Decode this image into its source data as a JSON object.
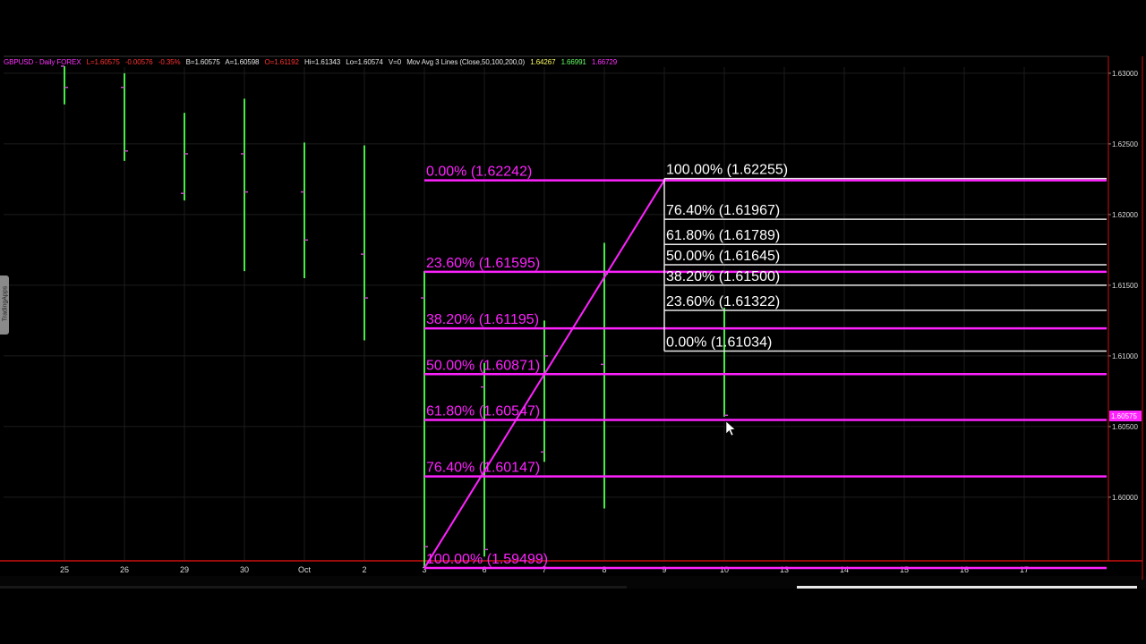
{
  "info": {
    "symbol": "GBPUSD - Daily FOREX",
    "last": "L=1.60575",
    "change": "-0.00576",
    "change_pct": "-0.35%",
    "bid": "B=1.60575",
    "ask": "A=1.60598",
    "open": "O=1.61192",
    "hi": "Hi=1.61343",
    "lo": "Lo=1.60574",
    "volume": "V=0",
    "ma_label": "Mov Avg 3 Lines (Close,50,100,200,0)",
    "ma1": "1.64267",
    "ma2": "1.66991",
    "ma3": "1.66729"
  },
  "side_tab": {
    "label": "TradingApps"
  },
  "colors": {
    "bar": "#44ee44",
    "fib_retrace": "#ff22ff",
    "fib_ext": "#e8e8e8",
    "axis": "#cc1111",
    "grid": "#1c1c1c",
    "price_tag": "#ff22ff"
  },
  "chart_data": {
    "type": "bar",
    "title": "",
    "xlabel": "",
    "ylabel": "",
    "ylim": [
      1.5955,
      1.6307
    ],
    "grid": true,
    "x_tick_labels": [
      "25",
      "26",
      "29",
      "30",
      "Oct",
      "2",
      "3",
      "6",
      "7",
      "8",
      "9",
      "10",
      "13",
      "14",
      "15",
      "16",
      "17"
    ],
    "y_tick_labels": [
      "1.63000",
      "1.62500",
      "1.62000",
      "1.61500",
      "1.61000",
      "1.60500",
      "1.60000"
    ],
    "y_tick_values": [
      1.63,
      1.625,
      1.62,
      1.615,
      1.61,
      1.605,
      1.6
    ],
    "current_price": "1.60575",
    "bars": [
      {
        "date": "25",
        "high": 1.6305,
        "low": 1.6278,
        "open": 1.6305,
        "close": 1.629
      },
      {
        "date": "26",
        "high": 1.63,
        "low": 1.6238,
        "open": 1.629,
        "close": 1.6245
      },
      {
        "date": "29",
        "high": 1.6272,
        "low": 1.621,
        "open": 1.6215,
        "close": 1.6243
      },
      {
        "date": "30",
        "high": 1.6282,
        "low": 1.616,
        "open": 1.6243,
        "close": 1.6216
      },
      {
        "date": "Oct",
        "high": 1.6251,
        "low": 1.6155,
        "open": 1.6216,
        "close": 1.6182
      },
      {
        "date": "2",
        "high": 1.6249,
        "low": 1.6111,
        "open": 1.6172,
        "close": 1.6141
      },
      {
        "date": "3",
        "high": 1.616,
        "low": 1.595,
        "open": 1.6141,
        "close": 1.5965
      },
      {
        "date": "6",
        "high": 1.6095,
        "low": 1.5958,
        "open": 1.6078,
        "close": 1.5963
      },
      {
        "date": "7",
        "high": 1.6125,
        "low": 1.6025,
        "open": 1.6032,
        "close": 1.61
      },
      {
        "date": "8",
        "high": 1.618,
        "low": 1.5992,
        "open": 1.6094,
        "close": 1.6158
      },
      {
        "date": "10",
        "high": 1.6134,
        "low": 1.6057,
        "open": 1.6119,
        "close": 1.6058
      }
    ],
    "fib_retracement": {
      "swing": {
        "from_date": "3",
        "from_price": 1.59499,
        "to_date": "9",
        "to_price": 1.62242
      },
      "levels": [
        {
          "label": "0.00% (1.62242)",
          "price": 1.62242
        },
        {
          "label": "23.60% (1.61595)",
          "price": 1.61595
        },
        {
          "label": "38.20% (1.61195)",
          "price": 1.61195
        },
        {
          "label": "50.00% (1.60871)",
          "price": 1.60871
        },
        {
          "label": "61.80% (1.60547)",
          "price": 1.60547
        },
        {
          "label": "76.40% (1.60147)",
          "price": 1.60147
        },
        {
          "label": "100.00% (1.59499)",
          "price": 1.59499
        }
      ]
    },
    "fib_extension": {
      "levels": [
        {
          "label": "100.00% (1.62255)",
          "price": 1.62255
        },
        {
          "label": "76.40% (1.61967)",
          "price": 1.61967
        },
        {
          "label": "61.80% (1.61789)",
          "price": 1.61789
        },
        {
          "label": "50.00% (1.61645)",
          "price": 1.61645
        },
        {
          "label": "38.20% (1.61500)",
          "price": 1.615
        },
        {
          "label": "23.60% (1.61322)",
          "price": 1.61322
        },
        {
          "label": "0.00% (1.61034)",
          "price": 1.61034
        }
      ]
    }
  }
}
